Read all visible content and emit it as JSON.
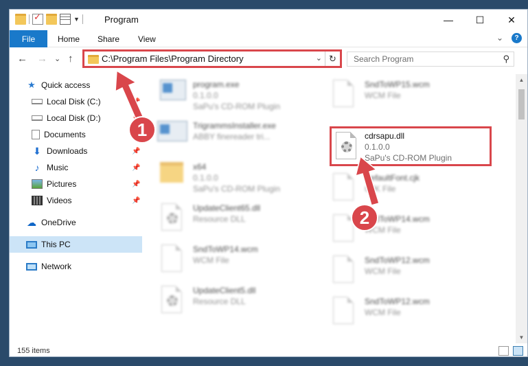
{
  "window": {
    "title": "Program",
    "controls": {
      "minimize": "—",
      "maximize": "☐",
      "close": "✕"
    }
  },
  "ribbon": {
    "tabs": [
      "File",
      "Home",
      "Share",
      "View"
    ],
    "expand": "⌄",
    "help": "?"
  },
  "navigation": {
    "back": "←",
    "forward": "→",
    "recent": "⌄",
    "up": "↑",
    "address": "C:\\Program Files\\Program Directory",
    "address_dropdown": "⌄",
    "refresh": "↻",
    "search_placeholder": "Search Program",
    "search_icon": "search-icon"
  },
  "sidebar": {
    "items": [
      {
        "label": "Quick access",
        "icon": "star-icon",
        "pinned": false
      },
      {
        "label": "Local Disk (C:)",
        "icon": "drive-icon",
        "pinned": true
      },
      {
        "label": "Local Disk (D:)",
        "icon": "drive-icon",
        "pinned": true
      },
      {
        "label": "Documents",
        "icon": "documents-icon",
        "pinned": true
      },
      {
        "label": "Downloads",
        "icon": "downloads-icon",
        "pinned": true
      },
      {
        "label": "Music",
        "icon": "music-icon",
        "pinned": true
      },
      {
        "label": "Pictures",
        "icon": "pictures-icon",
        "pinned": true
      },
      {
        "label": "Videos",
        "icon": "videos-icon",
        "pinned": true
      },
      {
        "label": "OneDrive",
        "icon": "onedrive-icon",
        "pinned": false
      },
      {
        "label": "This PC",
        "icon": "pc-icon",
        "pinned": false,
        "selected": true
      },
      {
        "label": "Network",
        "icon": "network-icon",
        "pinned": false
      }
    ]
  },
  "files": [
    {
      "name": "program.exe",
      "line1": "0.1.0.0",
      "line2": "SaPu's CD-ROM Plugin",
      "icon": "exe-icon"
    },
    {
      "name": "SndToWP15.wcm",
      "line1": "WCM File",
      "line2": "",
      "icon": "file-icon"
    },
    {
      "name": "TrigrammsInstaller.exe",
      "line1": "ABBY finereader tri...",
      "line2": "",
      "icon": "installer-icon"
    },
    {
      "name": "cdrsapu.dll",
      "line1": "0.1.0.0",
      "line2": "SaPu's CD-ROM Plugin",
      "icon": "dll-gear-icon"
    },
    {
      "name": "x64",
      "line1": "0.1.0.0",
      "line2": "SaPu's CD-ROM Plugin",
      "icon": "folder-icon"
    },
    {
      "name": "DefaultFont.cjk",
      "line1": "CJK File",
      "line2": "",
      "icon": "file-icon"
    },
    {
      "name": "UpdateClient65.dll",
      "line1": "Resource DLL",
      "line2": "",
      "icon": "dll-gear-icon"
    },
    {
      "name": "SndToWP14.wcm",
      "line1": "WCM File",
      "line2": "",
      "icon": "file-icon"
    },
    {
      "name": "SndToWP14.wcm",
      "line1": "WCM File",
      "line2": "",
      "icon": "file-icon"
    },
    {
      "name": "SndToWP12.wcm",
      "line1": "WCM File",
      "line2": "",
      "icon": "file-icon"
    },
    {
      "name": "UpdateClient5.dll",
      "line1": "Resource DLL",
      "line2": "",
      "icon": "dll-gear-icon"
    },
    {
      "name": "SndToWP12.wcm",
      "line1": "WCM File",
      "line2": "",
      "icon": "file-icon"
    }
  ],
  "status": {
    "items": "155 items"
  },
  "annotations": {
    "step1": "1",
    "step2": "2",
    "accent": "#d9464b"
  }
}
